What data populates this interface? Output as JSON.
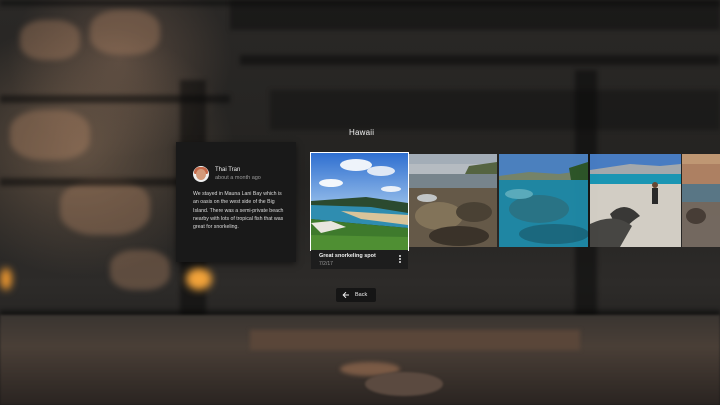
{
  "album": {
    "title": "Hawaii"
  },
  "comment": {
    "author": "Thai Tran",
    "time": "about a month ago",
    "text": "We stayed in Mauna Lani Bay which is an oasis on the west side of the Big Island. There was a semi-private beach nearby with lots of tropical fish that was great for snorkeling.",
    "avatar_icon": "user-avatar"
  },
  "photos": [
    {
      "title": "Great snorkeling spot",
      "date": "7/2/17",
      "selected": true
    },
    {
      "selected": false
    },
    {
      "selected": false
    },
    {
      "selected": false
    },
    {
      "selected": false
    }
  ],
  "icons": {
    "more": "more-vert-icon",
    "back": "arrow-left-icon"
  },
  "nav": {
    "back_label": "Back"
  }
}
